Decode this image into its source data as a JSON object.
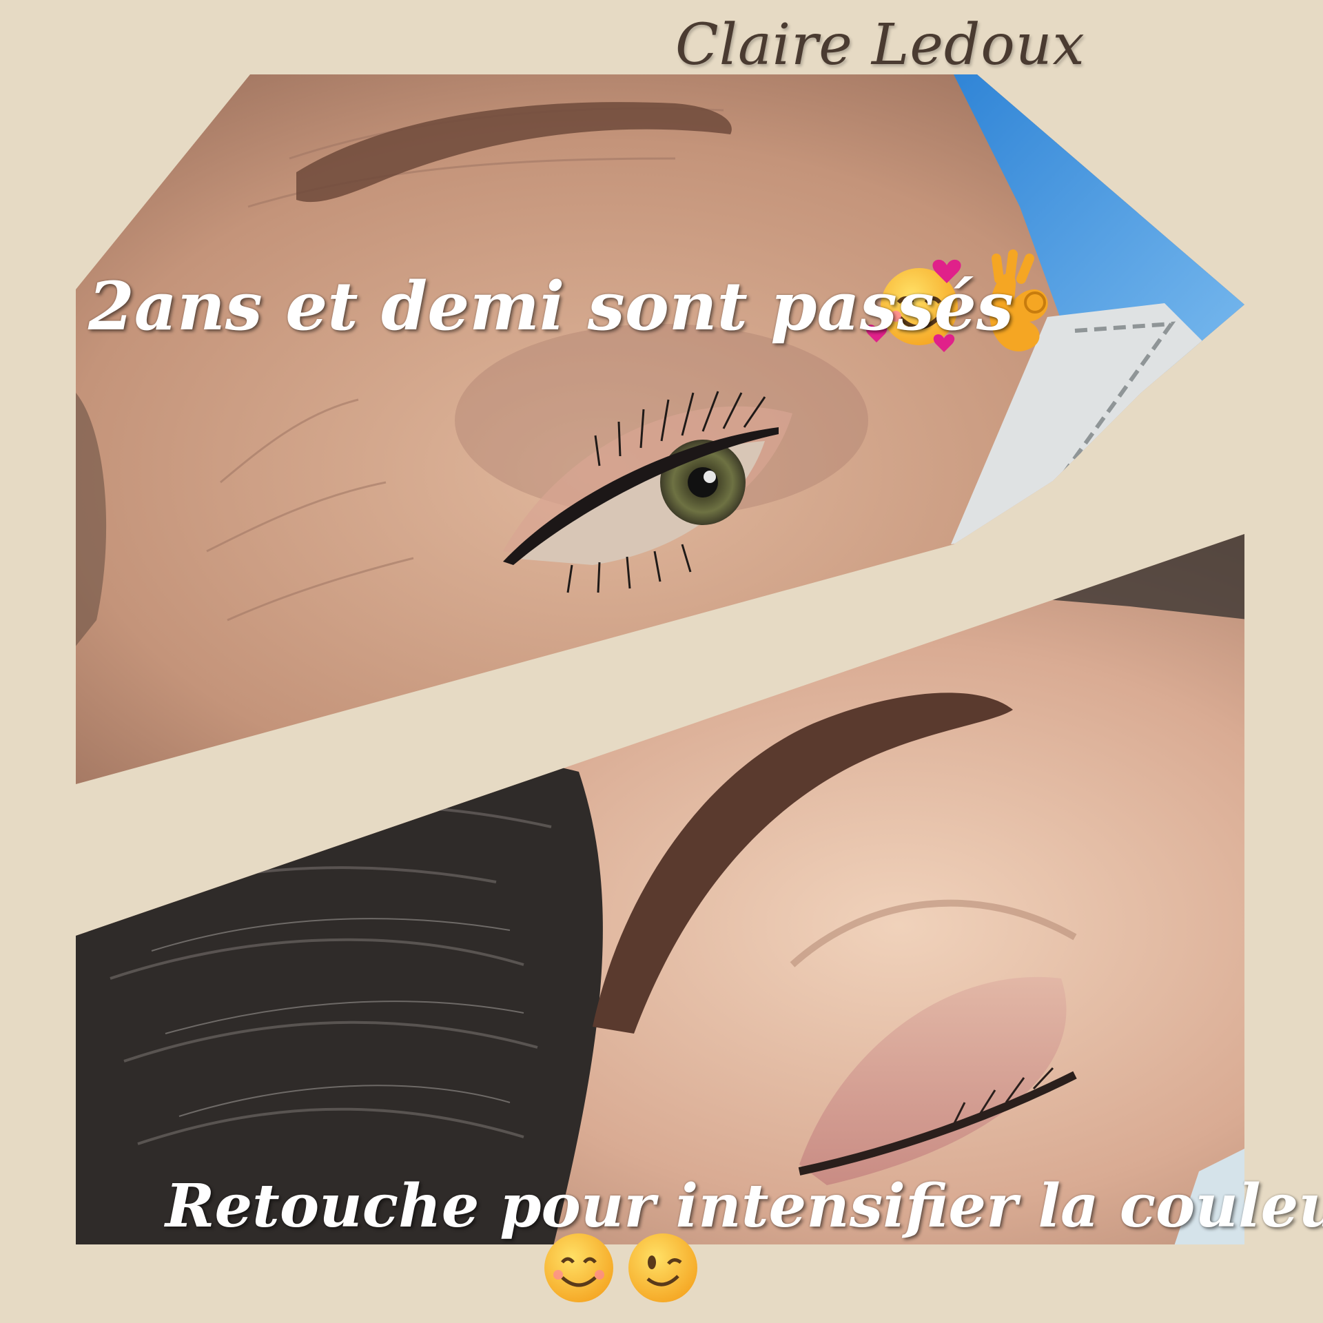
{
  "signature": "Claire Ledoux",
  "caption_top": "2ans et demi sont passés",
  "caption_bottom": "Retouche pour intensifier la couleur",
  "emojis_top": [
    "smiling-face-with-hearts",
    "ok-hand"
  ],
  "emojis_bottom": [
    "smiling-face",
    "winking-face"
  ],
  "colors": {
    "background": "#e6dac4",
    "skin": "#c99a7e",
    "brow": "#5a3a2e",
    "hair": "#2e2a28",
    "blue_backdrop": "#3f8fd8",
    "caption_text": "#ffffff",
    "signature_text": "#4a3b31"
  }
}
